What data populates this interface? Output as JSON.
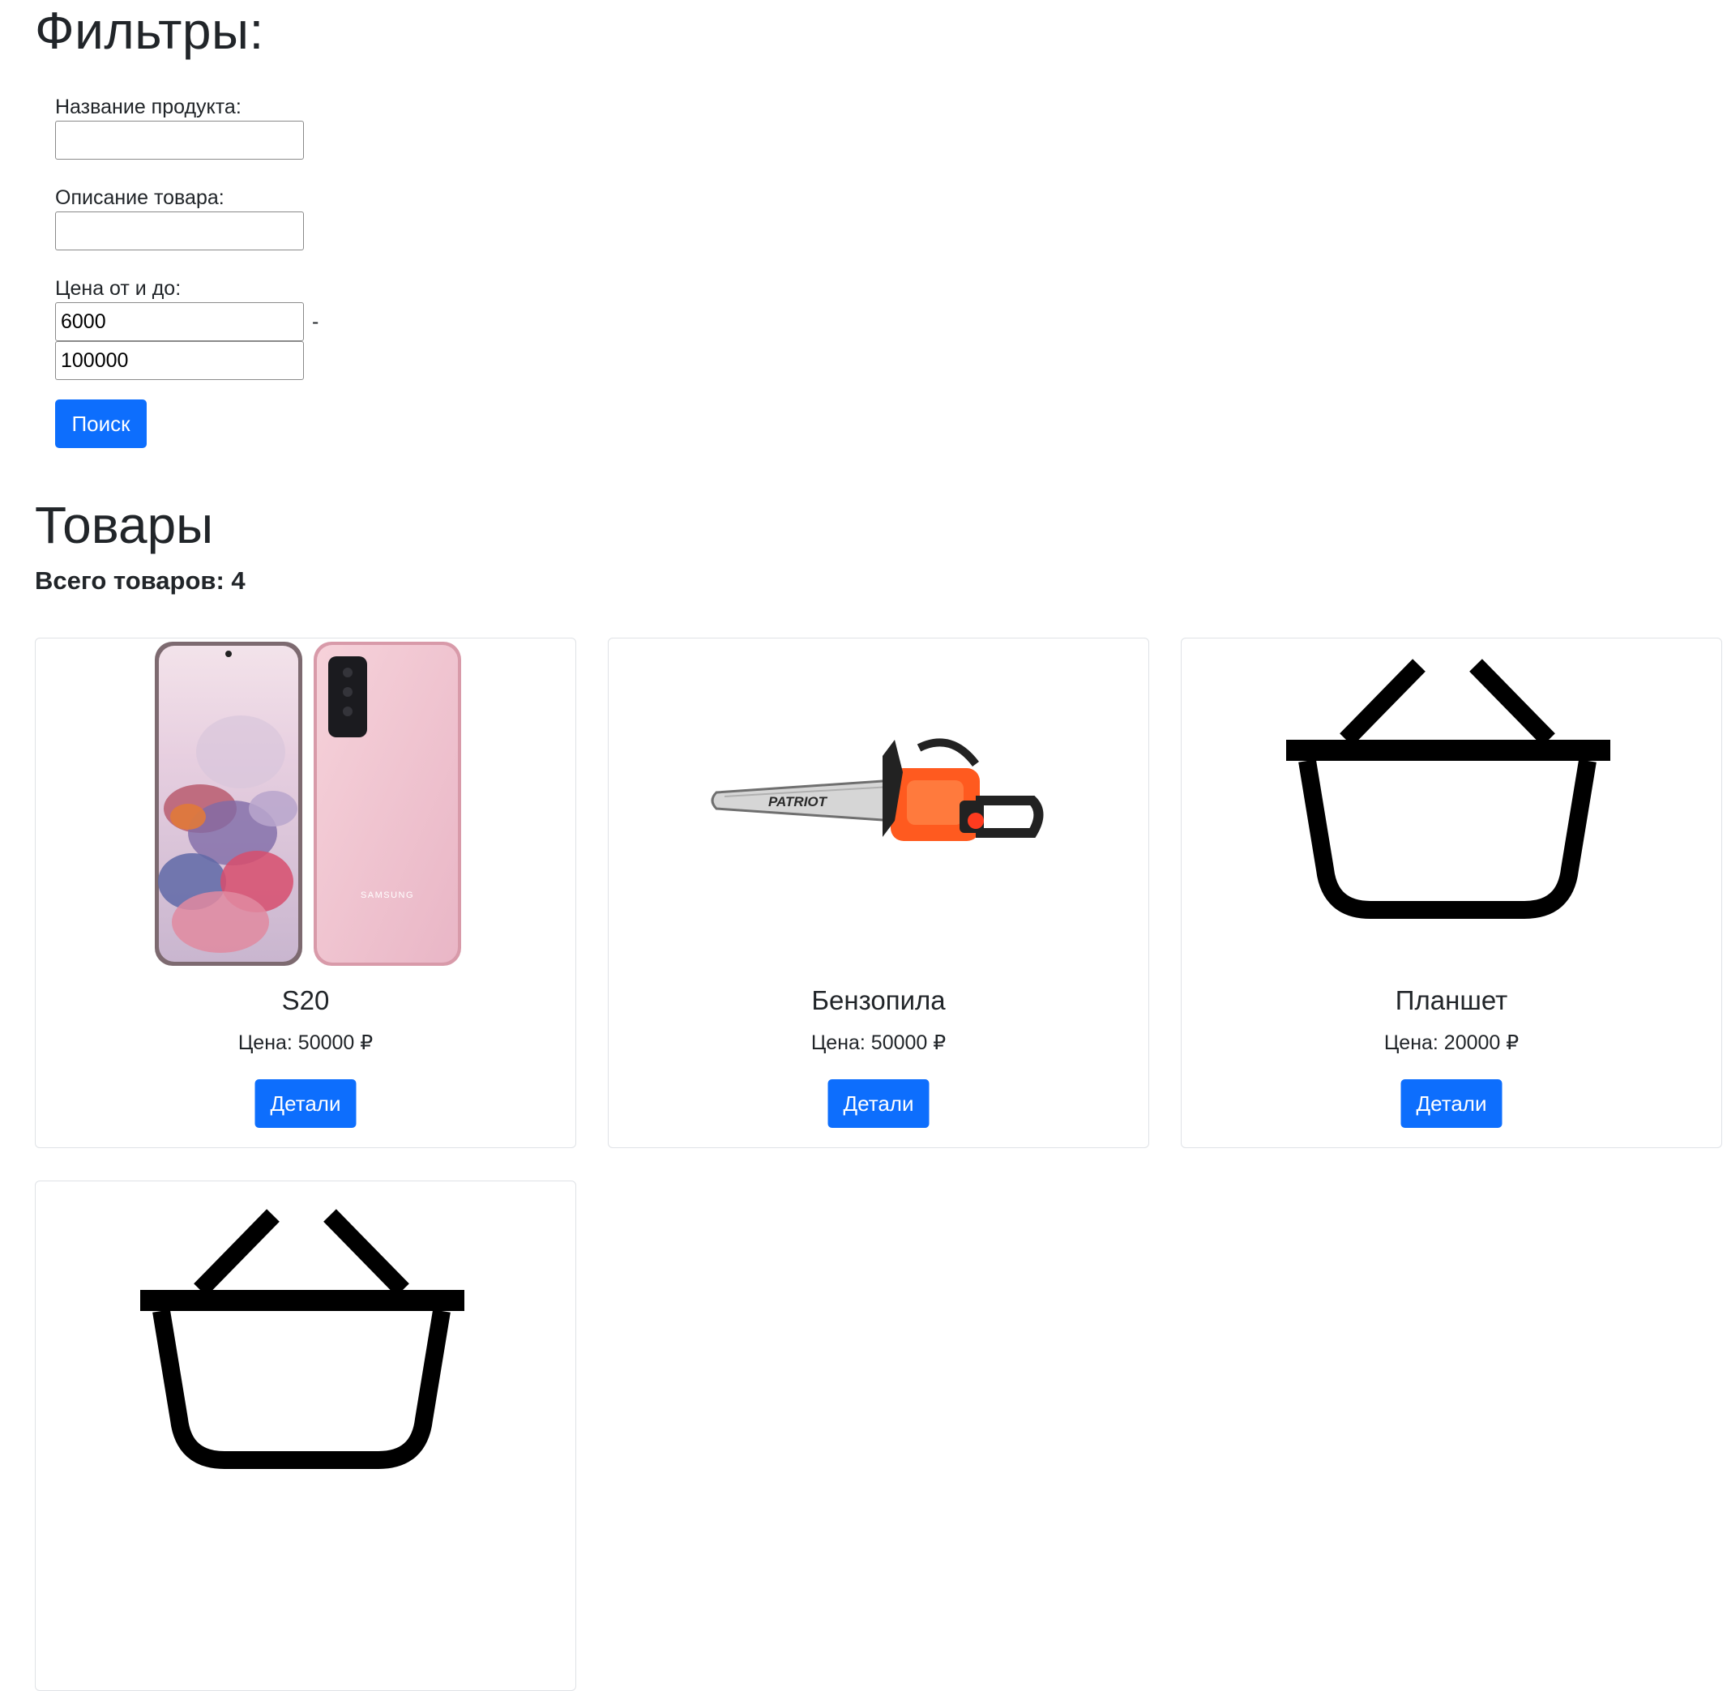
{
  "filters": {
    "title": "Фильтры:",
    "name_label": "Название продукта:",
    "name_value": "",
    "description_label": "Описание товара:",
    "description_value": "",
    "price_label": "Цена от и до:",
    "price_from": "6000",
    "price_separator": "-",
    "price_to": "100000",
    "search_button": "Поиск"
  },
  "products": {
    "title": "Товары",
    "total_text": "Всего товаров: 4",
    "items": [
      {
        "name": "S20",
        "price": "Цена: 50000 ₽",
        "button": "Детали",
        "image_icon": "smartphone-image"
      },
      {
        "name": "Бензопила",
        "price": "Цена: 50000 ₽",
        "button": "Детали",
        "image_icon": "chainsaw-image",
        "image_brand": "PATRIOT"
      },
      {
        "name": "Планшет",
        "price": "Цена: 20000 ₽",
        "button": "Детали",
        "image_icon": "basket-icon"
      },
      {
        "image_icon": "basket-icon"
      }
    ]
  },
  "colors": {
    "primary": "#0d6efd",
    "text": "#212529",
    "card_border": "#dfe2e6"
  }
}
